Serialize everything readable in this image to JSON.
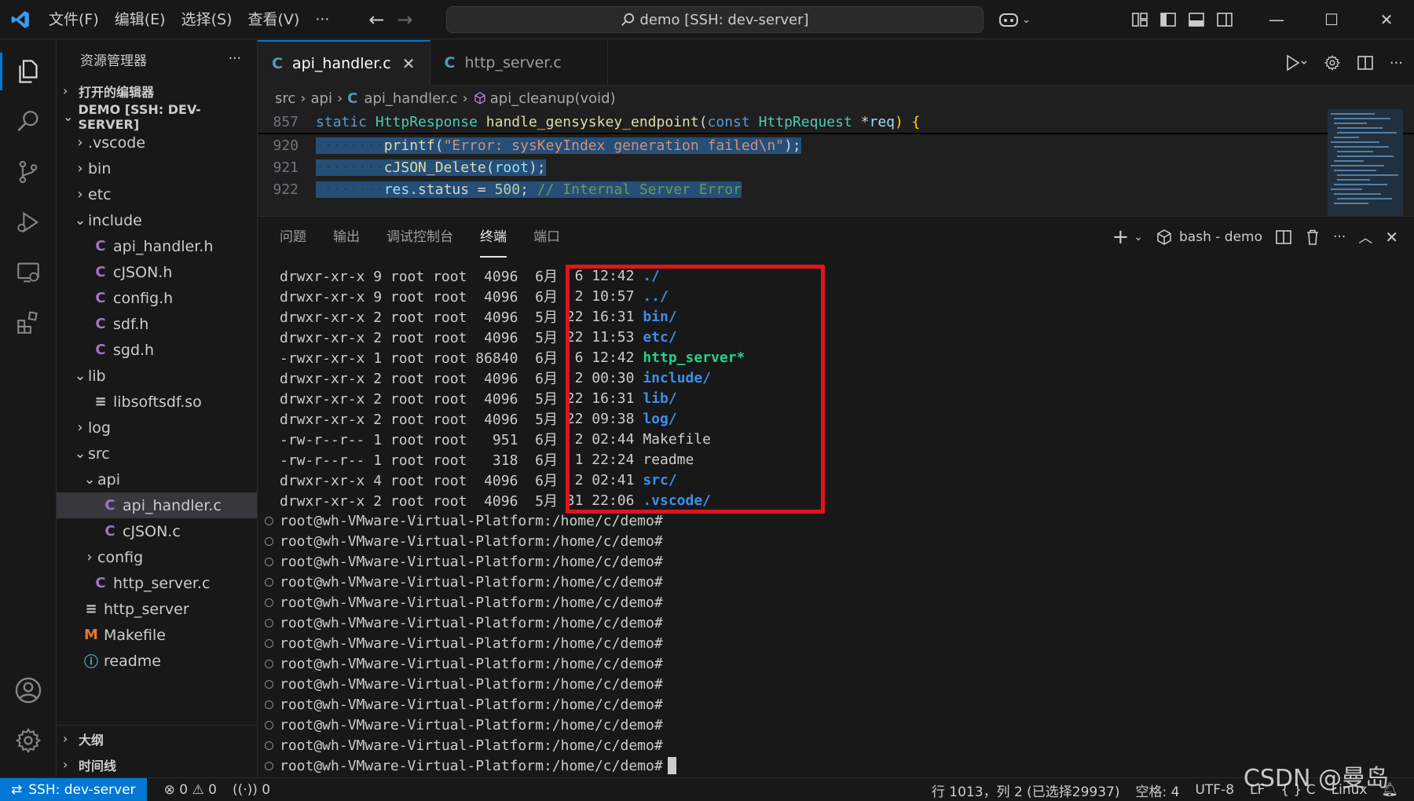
{
  "titlebar": {
    "menus": [
      "文件(F)",
      "编辑(E)",
      "选择(S)",
      "查看(V)",
      "···"
    ],
    "command_center": "demo [SSH: dev-server]"
  },
  "sidebar": {
    "title": "资源管理器",
    "more": "···",
    "open_editors": "打开的编辑器",
    "workspace": "DEMO [SSH: DEV-SERVER]",
    "tree": [
      {
        "label": ".vscode",
        "kind": "folder-closed",
        "depth": 1
      },
      {
        "label": "bin",
        "kind": "folder-closed",
        "depth": 1
      },
      {
        "label": "etc",
        "kind": "folder-closed",
        "depth": 1
      },
      {
        "label": "include",
        "kind": "folder-open",
        "depth": 1
      },
      {
        "label": "api_handler.h",
        "kind": "c",
        "depth": 2
      },
      {
        "label": "cJSON.h",
        "kind": "c",
        "depth": 2
      },
      {
        "label": "config.h",
        "kind": "c",
        "depth": 2
      },
      {
        "label": "sdf.h",
        "kind": "c",
        "depth": 2
      },
      {
        "label": "sgd.h",
        "kind": "c",
        "depth": 2
      },
      {
        "label": "lib",
        "kind": "folder-open",
        "depth": 1
      },
      {
        "label": "libsoftsdf.so",
        "kind": "lines",
        "depth": 2
      },
      {
        "label": "log",
        "kind": "folder-closed",
        "depth": 1
      },
      {
        "label": "src",
        "kind": "folder-open",
        "depth": 1
      },
      {
        "label": "api",
        "kind": "folder-open",
        "depth": 2
      },
      {
        "label": "api_handler.c",
        "kind": "c",
        "depth": 3,
        "selected": true
      },
      {
        "label": "cJSON.c",
        "kind": "c",
        "depth": 3
      },
      {
        "label": "config",
        "kind": "folder-closed",
        "depth": 2
      },
      {
        "label": "http_server.c",
        "kind": "c",
        "depth": 2
      },
      {
        "label": "http_server",
        "kind": "lines",
        "depth": 1
      },
      {
        "label": "Makefile",
        "kind": "makefile",
        "depth": 1
      },
      {
        "label": "readme",
        "kind": "info",
        "depth": 1
      }
    ],
    "outline": "大纲",
    "timeline": "时间线"
  },
  "editor": {
    "tabs": [
      {
        "label": "api_handler.c",
        "active": true
      },
      {
        "label": "http_server.c",
        "active": false
      }
    ],
    "breadcrumb": {
      "p1": "src",
      "p2": "api",
      "p3": "api_handler.c",
      "p4": "api_cleanup(void)"
    },
    "sticky": {
      "num": "857",
      "t1": "static",
      "t2": "HttpResponse",
      "t3": "handle_gensyskey_endpoint",
      "t4": "(",
      "t5": "const",
      "t6": "HttpRequest",
      "t7": " *",
      "t8": "req",
      "t9": ") {"
    },
    "lines": [
      {
        "num": "920",
        "ws": "········",
        "a": "printf",
        "b": "(",
        "c": "\"Error: sysKeyIndex generation failed\\n\"",
        "d": ");"
      },
      {
        "num": "921",
        "ws": "········",
        "a": "cJSON_Delete",
        "b": "(",
        "c": "root",
        "d": ");"
      },
      {
        "num": "922",
        "ws": "········",
        "a": "res",
        "b": ".status = ",
        "c": "500",
        "d": "; ",
        "e": "// Internal Server Error"
      }
    ]
  },
  "panel": {
    "tabs": [
      "问题",
      "输出",
      "调试控制台",
      "终端",
      "端口"
    ],
    "active_tab": "终端",
    "terminal_name": "bash - demo",
    "listing": [
      {
        "perm": "drwxr-xr-x 9 root root  4096  6月",
        "date": "  6 12:42 ",
        "name": "./",
        "style": "dir"
      },
      {
        "perm": "drwxr-xr-x 9 root root  4096  6月",
        "date": "  2 10:57 ",
        "name": "../",
        "style": "dir"
      },
      {
        "perm": "drwxr-xr-x 2 root root  4096  5月",
        "date": " 22 16:31 ",
        "name": "bin/",
        "style": "dir"
      },
      {
        "perm": "drwxr-xr-x 2 root root  4096  5月",
        "date": " 22 11:53 ",
        "name": "etc/",
        "style": "dir"
      },
      {
        "perm": "-rwxr-xr-x 1 root root 86840  6月",
        "date": "  6 12:42 ",
        "name": "http_server*",
        "style": "exe"
      },
      {
        "perm": "drwxr-xr-x 2 root root  4096  6月",
        "date": "  2 00:30 ",
        "name": "include/",
        "style": "dir"
      },
      {
        "perm": "drwxr-xr-x 2 root root  4096  5月",
        "date": " 22 16:31 ",
        "name": "lib/",
        "style": "dir"
      },
      {
        "perm": "drwxr-xr-x 2 root root  4096  5月",
        "date": " 22 09:38 ",
        "name": "log/",
        "style": "dir"
      },
      {
        "perm": "-rw-r--r-- 1 root root   951  6月",
        "date": "  2 02:44 ",
        "name": "Makefile",
        "style": "plain"
      },
      {
        "perm": "-rw-r--r-- 1 root root   318  6月",
        "date": "  1 22:24 ",
        "name": "readme",
        "style": "plain"
      },
      {
        "perm": "drwxr-xr-x 4 root root  4096  6月",
        "date": "  2 02:41 ",
        "name": "src/",
        "style": "dir"
      },
      {
        "perm": "drwxr-xr-x 2 root root  4096  5月",
        "date": " 31 22:06 ",
        "name": ".vscode/",
        "style": "dir"
      }
    ],
    "prompts": [
      "root@wh-VMware-Virtual-Platform:/home/c/demo#",
      "root@wh-VMware-Virtual-Platform:/home/c/demo#",
      "root@wh-VMware-Virtual-Platform:/home/c/demo#",
      "root@wh-VMware-Virtual-Platform:/home/c/demo#",
      "root@wh-VMware-Virtual-Platform:/home/c/demo#",
      "root@wh-VMware-Virtual-Platform:/home/c/demo#",
      "root@wh-VMware-Virtual-Platform:/home/c/demo#",
      "root@wh-VMware-Virtual-Platform:/home/c/demo#",
      "root@wh-VMware-Virtual-Platform:/home/c/demo#",
      "root@wh-VMware-Virtual-Platform:/home/c/demo#",
      "root@wh-VMware-Virtual-Platform:/home/c/demo#",
      "root@wh-VMware-Virtual-Platform:/home/c/demo#",
      "root@wh-VMware-Virtual-Platform:/home/c/demo#"
    ]
  },
  "statusbar": {
    "remote": "SSH: dev-server",
    "errors": "0",
    "warnings": "0",
    "ports": "0",
    "position": "行 1013，列 2 (已选择29937)",
    "spaces": "空格: 4",
    "encoding": "UTF-8",
    "eol": "LF",
    "language": "{ } C",
    "platform": "Linux"
  },
  "watermark": "CSDN @曼岛",
  "colors": {
    "accent": "#0078d4",
    "highlight_box": "#e1141e",
    "dir": "#3b8eea",
    "exe": "#23d18b"
  }
}
